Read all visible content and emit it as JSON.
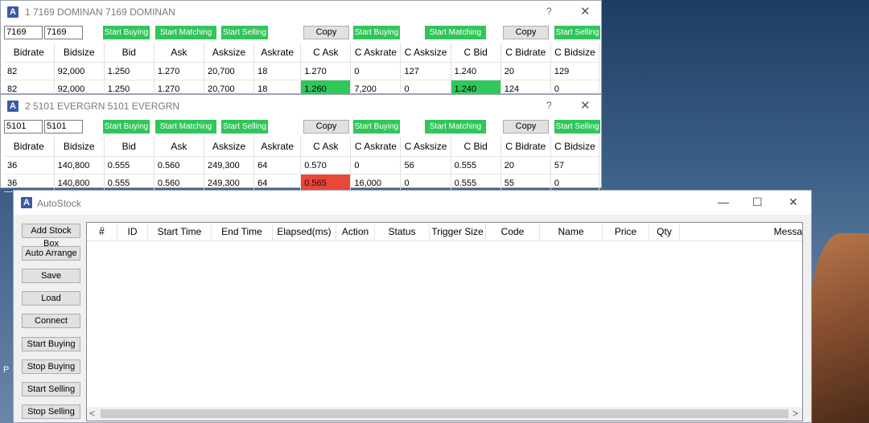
{
  "windows": [
    {
      "title": "1 7169 DOMINAN 7169 DOMINAN",
      "code1": "7169",
      "code2": "7169",
      "rows": [
        [
          "82",
          "92,000",
          "1.250",
          "1.270",
          "20,700",
          "18",
          "1.270",
          "0",
          "127",
          "1.240",
          "20",
          "129"
        ],
        [
          "82",
          "92,000",
          "1.250",
          "1.270",
          "20,700",
          "18",
          "1.260",
          "7,200",
          "0",
          "1.240",
          "124",
          "0"
        ]
      ]
    },
    {
      "title": "2 5101 EVERGRN 5101 EVERGRN",
      "code1": "5101",
      "code2": "5101",
      "rows": [
        [
          "36",
          "140,800",
          "0.555",
          "0.560",
          "249,300",
          "64",
          "0.570",
          "0",
          "56",
          "0.555",
          "20",
          "57"
        ],
        [
          "36",
          "140,800",
          "0.555",
          "0.560",
          "249,300",
          "64",
          "0.565",
          "16,000",
          "0",
          "0.555",
          "55",
          "0"
        ]
      ]
    }
  ],
  "common": {
    "icon_letter": "A",
    "help": "?",
    "close": "✕",
    "start_buying": "Start Buying",
    "start_matching": "Start Matching",
    "start_selling": "Start Selling",
    "copy": "Copy",
    "columns": [
      "Bidrate",
      "Bidsize",
      "Bid",
      "Ask",
      "Asksize",
      "Askrate",
      "C Ask",
      "C Askrate",
      "C Asksize",
      "C Bid",
      "C Bidrate",
      "C Bidsize"
    ],
    "green": "#31c55a",
    "red": "#e8473a"
  },
  "autostock": {
    "title": "AutoStock",
    "minimize": "—",
    "maximize": "☐",
    "close": "✕",
    "buttons": [
      "Add Stock Box",
      "Auto Arrange",
      "Save",
      "Load",
      "Connect",
      "Start Buying",
      "Stop Buying",
      "Start Selling",
      "Stop Selling"
    ],
    "columns": [
      "#",
      "ID",
      "Start Time",
      "End Time",
      "Elapsed(ms)",
      "Action",
      "Status",
      "Trigger Size",
      "Code",
      "Name",
      "Price",
      "Qty",
      "Messa"
    ],
    "sort_caret": "⌄",
    "scroll_left": "<",
    "scroll_right": ">"
  },
  "desktop": {
    "left_label": "P"
  }
}
